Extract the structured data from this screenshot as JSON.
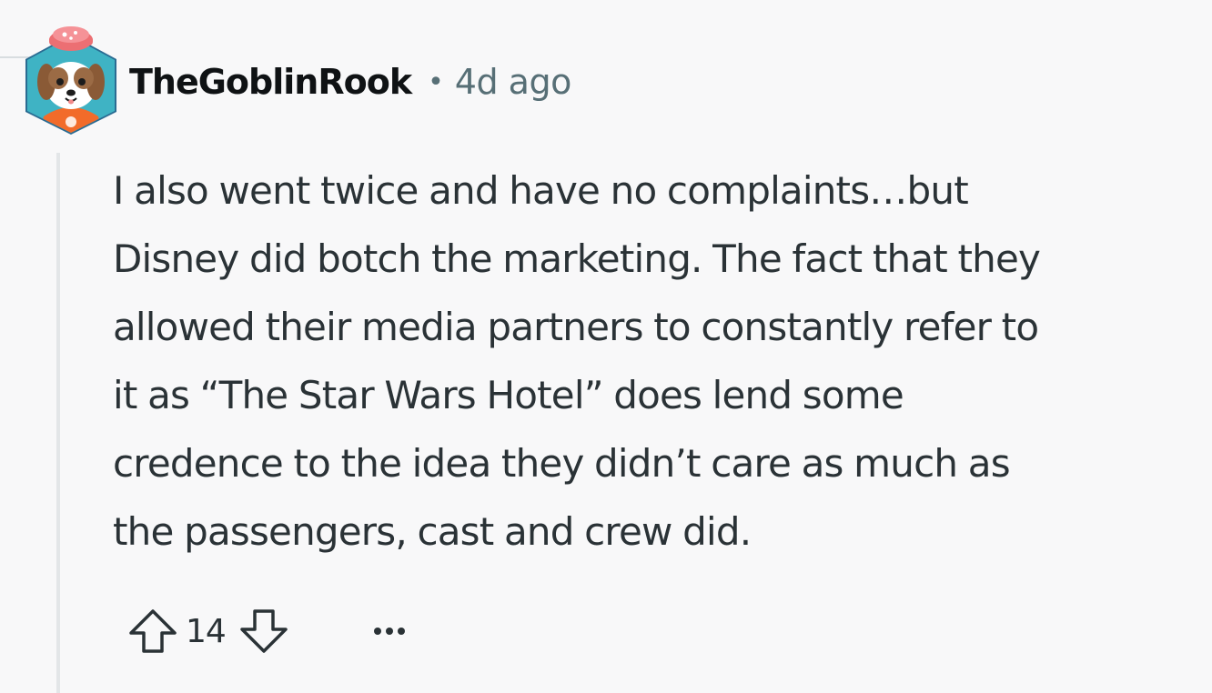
{
  "comment": {
    "author": "TheGoblinRook",
    "separator": "•",
    "timestamp": "4d ago",
    "body_lines": [
      "I also went twice and have no complaints…but",
      "Disney did botch the marketing. The fact that they",
      "allowed their media partners to constantly refer to",
      "it as “The Star Wars Hotel” does lend some",
      "credence to the idea they didn’t care as much as",
      "the passengers, cast and crew did."
    ],
    "score": "14",
    "avatar_icon": "dog-avatar-icon",
    "upvote_icon": "arrow-up-outline-icon",
    "downvote_icon": "arrow-down-outline-icon",
    "more_icon": "ellipsis-horizontal-icon"
  },
  "colors": {
    "background": "#f8f8f9",
    "username": "#0f1214",
    "meta": "#576f76",
    "body": "#2a3236",
    "thread_line": "#e3e6e8",
    "avatar_frame": "#2a6b92",
    "avatar_shirt": "#f26b2a"
  }
}
